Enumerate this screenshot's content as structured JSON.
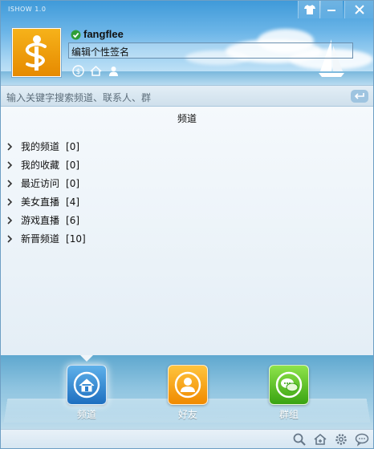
{
  "app": {
    "title": "ISHOW 1.0"
  },
  "titlebar": {
    "skin_icon": "shirt-icon",
    "minimize_icon": "minimize-icon",
    "close_icon": "close-icon"
  },
  "profile": {
    "username": "fangflee",
    "status_icon": "online-check-icon",
    "signature": "编辑个性签名",
    "mini_icons": [
      "coin-icon",
      "home-icon",
      "user-icon"
    ]
  },
  "search": {
    "placeholder": "输入关键字搜索频道、联系人、群",
    "enter_icon": "enter-icon"
  },
  "channels": {
    "title": "频道",
    "items": [
      {
        "label": "我的频道",
        "count": "[0]"
      },
      {
        "label": "我的收藏",
        "count": "[0]"
      },
      {
        "label": "最近访问",
        "count": "[0]"
      },
      {
        "label": "美女直播",
        "count": "[4]"
      },
      {
        "label": "游戏直播",
        "count": "[6]"
      },
      {
        "label": "新晋频道",
        "count": "[10]"
      }
    ]
  },
  "bottom_nav": {
    "tabs": [
      {
        "label": "频道",
        "icon": "home-icon",
        "active": true
      },
      {
        "label": "好友",
        "icon": "friend-icon",
        "active": false
      },
      {
        "label": "群组",
        "icon": "group-chat-icon",
        "active": false
      }
    ]
  },
  "footer": {
    "icons": [
      "search-icon",
      "home-add-icon",
      "settings-icon",
      "message-icon"
    ]
  },
  "colors": {
    "accent": "#1e6fc0",
    "header": "#4fa3dc",
    "friends": "#f5a21a",
    "groups": "#4fb61e"
  }
}
